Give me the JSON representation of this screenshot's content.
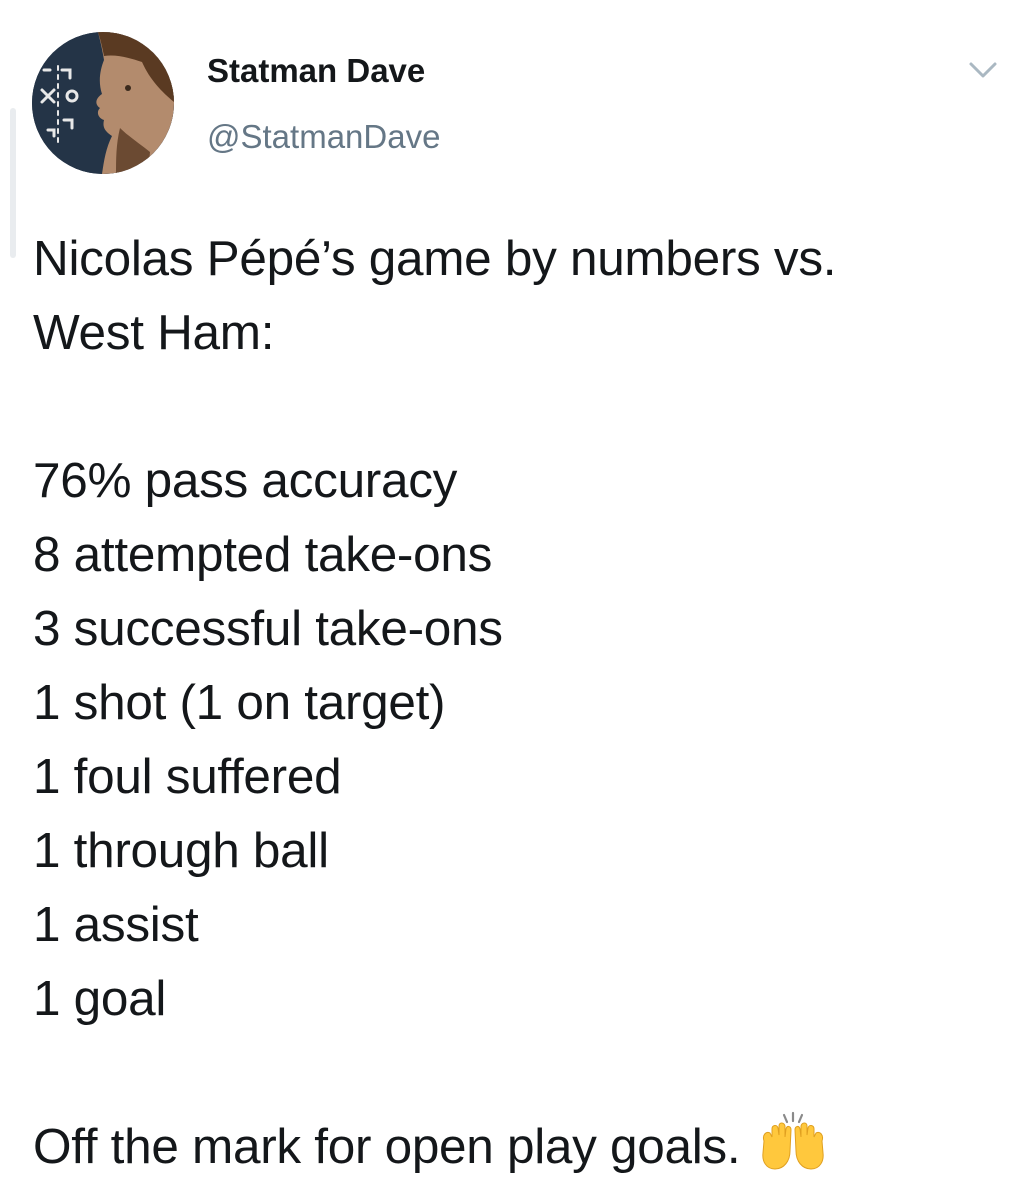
{
  "tweet": {
    "author": {
      "display_name": "Statman Dave",
      "handle": "@StatmanDave",
      "avatar_icon": "avatar-tactics-board-profile"
    },
    "menu_icon": "chevron-down-icon",
    "text": {
      "intro_line_1": "Nicolas Pépé’s game by numbers vs.",
      "intro_line_2": "West Ham:",
      "stats": [
        "76% pass accuracy",
        "8 attempted take-ons",
        "3 successful take-ons",
        "1 shot (1 on target)",
        "1 foul suffered",
        "1 through ball",
        "1 assist",
        "1 goal"
      ],
      "outro": "Off the mark for open play goals.",
      "emoji": "raising-hands-emoji"
    }
  },
  "colors": {
    "text_primary": "#14171a",
    "text_secondary": "#657786",
    "emoji_yellow": "#ffc83d",
    "avatar_bg": "#243447"
  }
}
